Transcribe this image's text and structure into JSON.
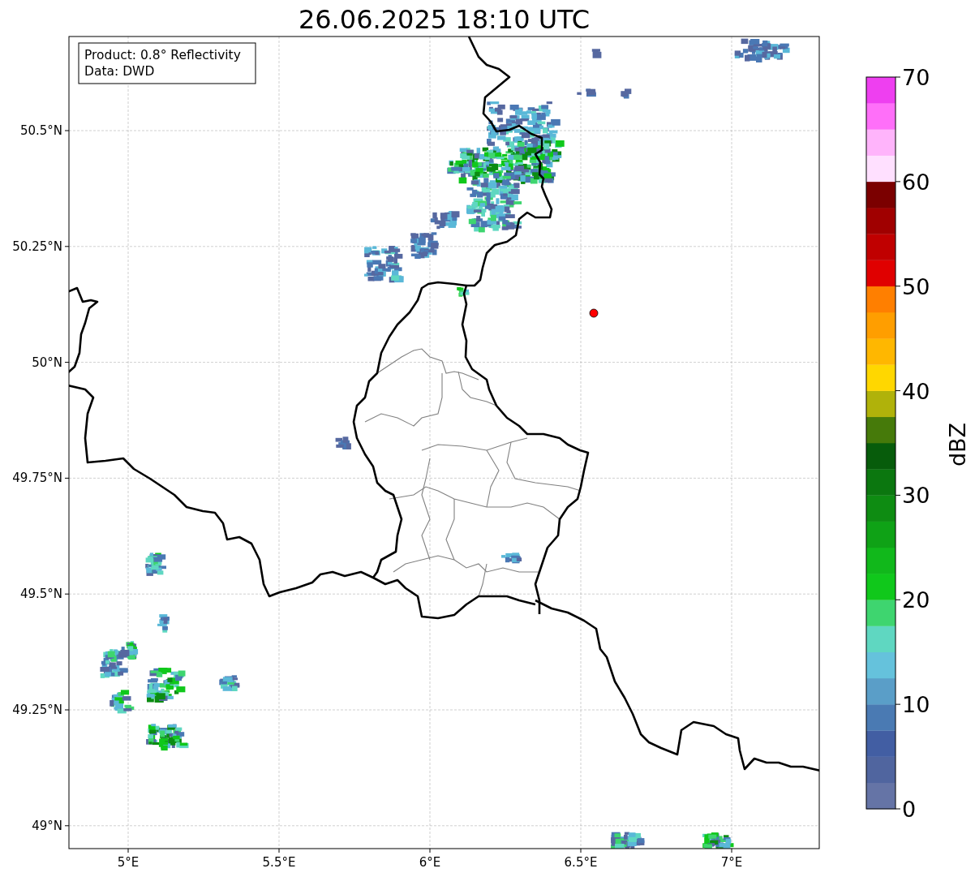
{
  "title": "26.06.2025 18:10 UTC",
  "info_box": {
    "lines": [
      "Product: 0.8° Reflectivity",
      "Data: DWD"
    ]
  },
  "map": {
    "x_ticks": [
      "5°E",
      "5.5°E",
      "6°E",
      "6.5°E",
      "7°E"
    ],
    "y_ticks": [
      "50.5°N",
      "50.25°N",
      "50°N",
      "49.75°N",
      "49.5°N",
      "49.25°N",
      "49°N"
    ]
  },
  "colorbar": {
    "label": "dBZ",
    "ticks": [
      "70",
      "60",
      "50",
      "40",
      "30",
      "20",
      "10",
      "0"
    ],
    "segments": [
      {
        "color": "#6574a6"
      },
      {
        "color": "#50659f"
      },
      {
        "color": "#425ea3"
      },
      {
        "color": "#4a7ab3"
      },
      {
        "color": "#5a9ec8"
      },
      {
        "color": "#65c2dc"
      },
      {
        "color": "#5fd7c1"
      },
      {
        "color": "#3ed56f"
      },
      {
        "color": "#10c81b"
      },
      {
        "color": "#11b81b"
      },
      {
        "color": "#0fa216"
      },
      {
        "color": "#0e8c12"
      },
      {
        "color": "#0b770f"
      },
      {
        "color": "#075c0b"
      },
      {
        "color": "#467a0a"
      },
      {
        "color": "#b0b20a"
      },
      {
        "color": "#ffd700"
      },
      {
        "color": "#ffb700"
      },
      {
        "color": "#ff9e00"
      },
      {
        "color": "#ff7f00"
      },
      {
        "color": "#e00000"
      },
      {
        "color": "#c00000"
      },
      {
        "color": "#a00000"
      },
      {
        "color": "#7b0000"
      },
      {
        "color": "#ffe0ff"
      },
      {
        "color": "#ffb4fb"
      },
      {
        "color": "#ff6ff9"
      },
      {
        "color": "#ee3ff0"
      }
    ]
  }
}
